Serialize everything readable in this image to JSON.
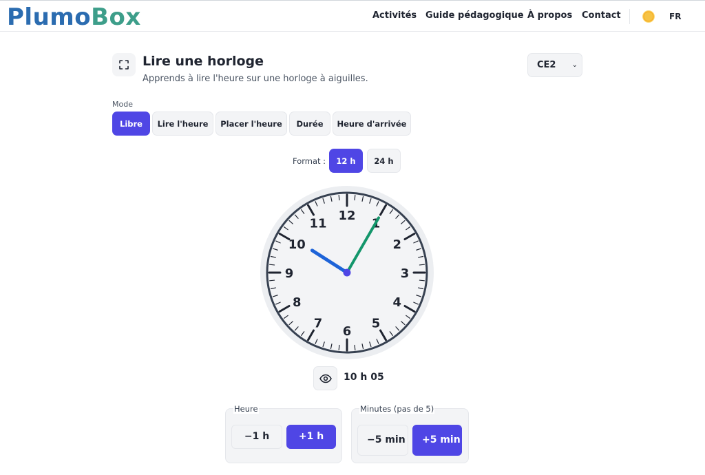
{
  "header": {
    "logo_part1": "Plumo",
    "logo_part2": "Box",
    "nav": [
      "Activités",
      "Guide pédagogique",
      "À propos",
      "Contact"
    ],
    "theme_icon": "sun-icon",
    "lang": "FR"
  },
  "page": {
    "title": "Lire une horloge",
    "subtitle": "Apprends à lire l'heure sur une horloge à aiguilles.",
    "level": "CE2",
    "fullscreen_icon": "fullscreen-icon"
  },
  "mode": {
    "label": "Mode",
    "options": [
      "Libre",
      "Lire l'heure",
      "Placer l'heure",
      "Durée",
      "Heure d'arrivée"
    ],
    "selected": "Libre"
  },
  "format": {
    "label": "Format :",
    "options": [
      "12 h",
      "24 h"
    ],
    "selected": "12 h"
  },
  "clock": {
    "numbers": [
      "12",
      "1",
      "2",
      "3",
      "4",
      "5",
      "6",
      "7",
      "8",
      "9",
      "10",
      "11"
    ],
    "hour": 10,
    "minute": 5,
    "hour_hand_color": "#1d63d8",
    "minute_hand_color": "#13966b",
    "center_color": "#4f46e5"
  },
  "readout": {
    "eye_icon": "eye-icon",
    "time_text": "10 h 05"
  },
  "controls": {
    "hour_label": "Heure",
    "hour_minus": "−1 h",
    "hour_plus": "+1 h",
    "minute_label": "Minutes (pas de 5)",
    "minute_minus": "−5 min",
    "minute_plus": "+5 min"
  },
  "colors": {
    "accent": "#4f46e5",
    "logo_blue": "#2b6cb0",
    "logo_green": "#3d9e8a"
  }
}
